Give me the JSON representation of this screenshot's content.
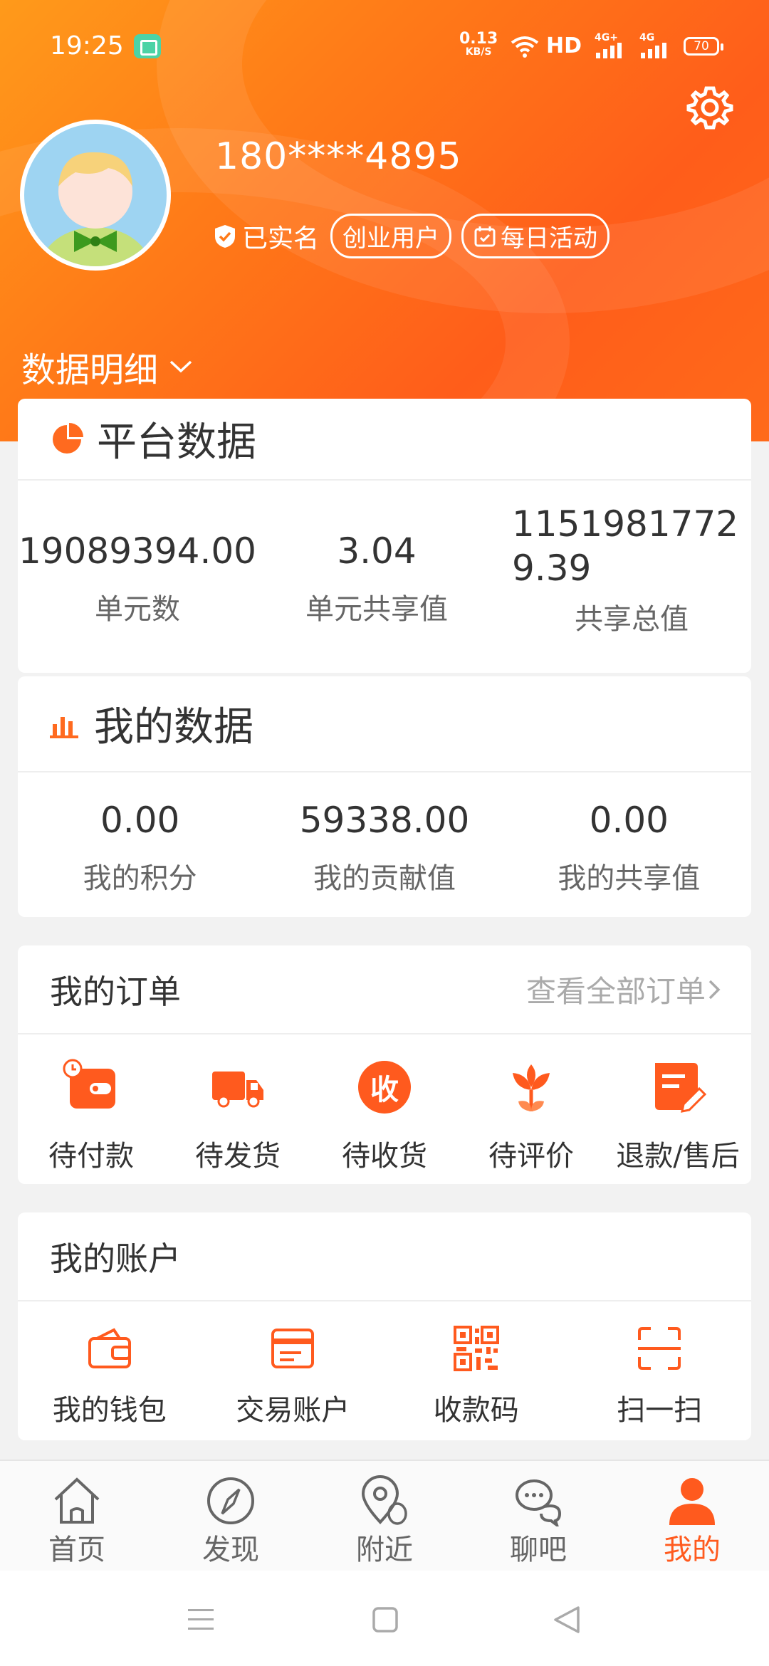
{
  "status_bar": {
    "time": "19:25",
    "net_speed_value": "0.13",
    "net_speed_unit": "KB/S",
    "hd_label": "HD",
    "signal_label_1": "4G+",
    "signal_label_2": "4G",
    "battery": "70"
  },
  "profile": {
    "phone": "180****4895",
    "verified_label": "已实名",
    "user_type_label": "创业用户",
    "daily_activity_label": "每日活动"
  },
  "data_detail_label": "数据明细",
  "platform_data": {
    "title": "平台数据",
    "stats": [
      {
        "value": "19089394.00",
        "label": "单元数"
      },
      {
        "value": "3.04",
        "label": "单元共享值"
      },
      {
        "value": "11519817729.39",
        "label": "共享总值"
      }
    ]
  },
  "my_data": {
    "title": "我的数据",
    "stats": [
      {
        "value": "0.00",
        "label": "我的积分"
      },
      {
        "value": "59338.00",
        "label": "我的贡献值"
      },
      {
        "value": "0.00",
        "label": "我的共享值"
      }
    ]
  },
  "orders": {
    "title": "我的订单",
    "view_all": "查看全部订单",
    "items": [
      {
        "label": "待付款",
        "icon": "wallet-clock-icon"
      },
      {
        "label": "待发货",
        "icon": "truck-icon"
      },
      {
        "label": "待收货",
        "icon": "receive-icon",
        "glyph": "收"
      },
      {
        "label": "待评价",
        "icon": "flower-icon"
      },
      {
        "label": "退款/售后",
        "icon": "edit-note-icon"
      }
    ]
  },
  "account": {
    "title": "我的账户",
    "items": [
      {
        "label": "我的钱包",
        "icon": "wallet-icon"
      },
      {
        "label": "交易账户",
        "icon": "card-icon"
      },
      {
        "label": "收款码",
        "icon": "qr-code-icon"
      },
      {
        "label": "扫一扫",
        "icon": "scan-icon"
      }
    ]
  },
  "bottom_nav": [
    {
      "label": "首页",
      "icon": "home-icon"
    },
    {
      "label": "发现",
      "icon": "compass-icon"
    },
    {
      "label": "附近",
      "icon": "location-icon"
    },
    {
      "label": "聊吧",
      "icon": "chat-icon"
    },
    {
      "label": "我的",
      "icon": "user-icon",
      "active": true
    }
  ],
  "colors": {
    "accent": "#ff5a1e",
    "header_start": "#ff9a1a",
    "header_end": "#ff5d1a",
    "icon_orange": "#ff6a1f"
  }
}
